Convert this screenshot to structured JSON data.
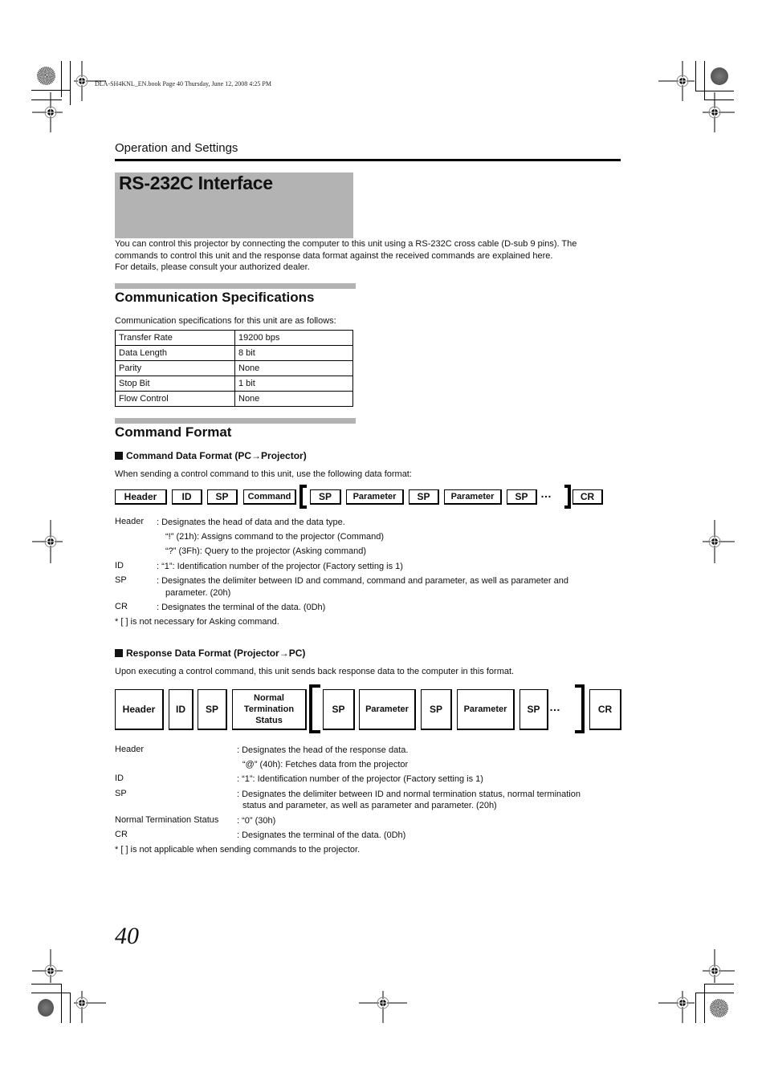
{
  "slug": "DLA-SH4KNL_EN.book  Page 40  Thursday, June 12, 2008  4:25 PM",
  "section_header": "Operation and Settings",
  "title": "RS-232C Interface",
  "intro": [
    "You can control this projector by connecting the computer to this unit using a RS-232C cross cable (D-sub 9 pins). The",
    "commands to control this unit and the response data format against the received commands are explained here.",
    "For details, please consult your authorized dealer."
  ],
  "comm_spec": {
    "heading": "Communication Specifications",
    "lead": "Communication specifications for this unit are as follows:",
    "rows": [
      {
        "label": "Transfer Rate",
        "value": "19200 bps"
      },
      {
        "label": "Data Length",
        "value": "8 bit"
      },
      {
        "label": "Parity",
        "value": "None"
      },
      {
        "label": "Stop Bit",
        "value": "1 bit"
      },
      {
        "label": "Flow Control",
        "value": "None"
      }
    ]
  },
  "command_format": {
    "heading": "Command Format",
    "command_data": {
      "subheading": "Command Data Format (PC→Projector)",
      "lead": "When sending a control command to this unit, use the following data format:",
      "boxes": [
        "Header",
        "ID",
        "SP",
        "Command",
        "SP",
        "Parameter",
        "SP",
        "Parameter",
        "SP",
        "CR"
      ],
      "ellipsis": "…",
      "definitions": [
        {
          "term": "Header",
          "text": ": Designates the head of data and the data type."
        },
        {
          "term": "",
          "text": "“!” (21h): Assigns command to the projector (Command)"
        },
        {
          "term": "",
          "text": "“?” (3Fh): Query to the projector (Asking command)"
        },
        {
          "term": "ID",
          "text": ": “1”: Identification number of the projector (Factory setting is 1)"
        },
        {
          "term": "SP",
          "text": ": Designates the delimiter between ID and command, command and parameter, as well as parameter and"
        },
        {
          "term": "",
          "text": "parameter. (20h)"
        },
        {
          "term": "CR",
          "text": ": Designates the terminal of the data. (0Dh)"
        }
      ],
      "note": "* [ ] is not necessary for Asking command."
    },
    "response_data": {
      "subheading": "Response Data Format (Projector→PC)",
      "lead": "Upon executing a control command, this unit sends back response data to the computer in this format.",
      "boxes": [
        "Header",
        "ID",
        "SP",
        "Normal Termination Status",
        "SP",
        "Parameter",
        "SP",
        "Parameter",
        "SP",
        "CR"
      ],
      "ellipsis": "…",
      "definitions": [
        {
          "term": "Header",
          "text": ": Designates the head of the response data."
        },
        {
          "term": "",
          "text": "“@” (40h): Fetches data from the projector"
        },
        {
          "term": "ID",
          "text": ": “1”: Identification number of the projector (Factory setting is 1)"
        },
        {
          "term": "SP",
          "text": ": Designates the delimiter between ID and normal termination status, normal termination"
        },
        {
          "term": "",
          "text": "status and parameter, as well as parameter and parameter. (20h)"
        },
        {
          "term": "Normal Termination Status",
          "text": ": “0” (30h)"
        },
        {
          "term": "CR",
          "text": ": Designates the terminal of the data. (0Dh)"
        }
      ],
      "note": "* [ ] is not applicable when sending commands to the projector."
    }
  },
  "page_number": "40"
}
